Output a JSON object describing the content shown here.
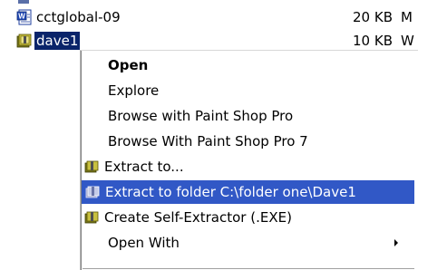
{
  "files": [
    {
      "name": "cctglobal-09",
      "size": "20 KB",
      "type": "M",
      "icon": "word-document-icon",
      "selected": false
    },
    {
      "name": "dave1",
      "size": "10 KB",
      "type": "W",
      "icon": "winzip-archive-icon",
      "selected": true
    }
  ],
  "menu": {
    "items": [
      {
        "label": "Open",
        "bold": true
      },
      {
        "label": "Explore"
      },
      {
        "label": "Browse with Paint Shop Pro"
      },
      {
        "label": "Browse With Paint Shop Pro 7"
      },
      {
        "label": "Extract to...",
        "icon": "winzip-icon"
      },
      {
        "label": "Extract to folder C:\\folder one\\Dave1",
        "icon": "winzip-icon",
        "highlighted": true
      },
      {
        "label": "Create Self-Extractor (.EXE)",
        "icon": "winzip-icon"
      },
      {
        "label": "Open With",
        "submenu": true
      }
    ]
  },
  "colors": {
    "selection": "#0a246a",
    "menu_highlight": "#3158c6"
  }
}
